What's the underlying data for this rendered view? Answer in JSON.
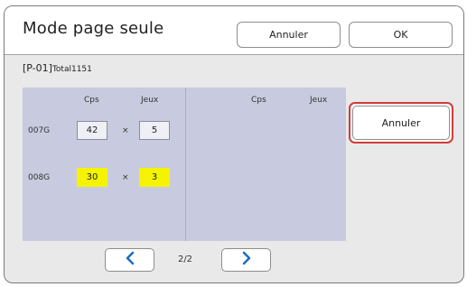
{
  "header": {
    "title": "Mode page seule",
    "cancel_label": "Annuler",
    "ok_label": "OK"
  },
  "info": {
    "prefix": "[P-01]",
    "label": "Total1151"
  },
  "left_panel": {
    "col_copies": "Cps",
    "col_sets": "Jeux",
    "rows": [
      {
        "label": "007G",
        "copies": "42",
        "sets": "5",
        "highlighted": false
      },
      {
        "label": "008G",
        "copies": "30",
        "sets": "3",
        "highlighted": true
      }
    ],
    "times_symbol": "×"
  },
  "right_panel": {
    "col_copies": "Cps",
    "col_sets": "Jeux"
  },
  "side_cancel_label": "Annuler",
  "pagination": {
    "current": "2/2",
    "prev_icon": "chevron-left-icon",
    "next_icon": "chevron-right-icon"
  },
  "colors": {
    "accent": "#1e6fbf",
    "highlight": "#f5f300",
    "panel": "#c8cbdf",
    "alert_border": "#d23b3b"
  }
}
